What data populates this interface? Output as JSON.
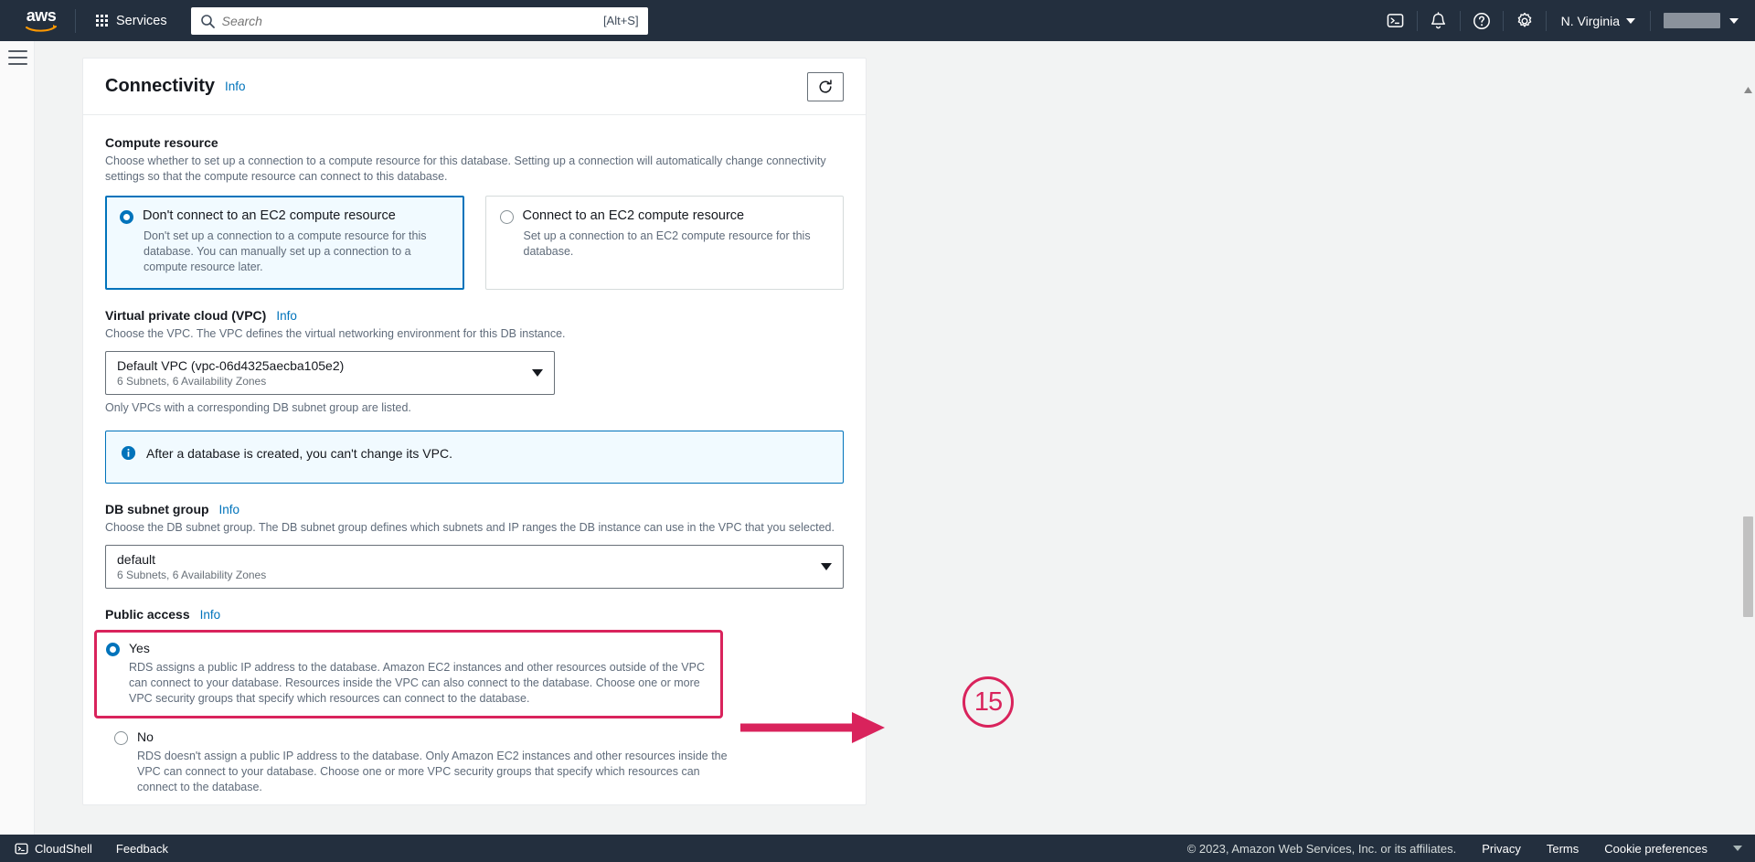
{
  "topnav": {
    "logo_alt": "aws",
    "services_label": "Services",
    "search_placeholder": "Search",
    "search_value": "",
    "search_shortcut": "[Alt+S]",
    "cloudshell_icon": "cloudshell-icon",
    "notifications_icon": "bell-icon",
    "help_icon": "question-circle-icon",
    "settings_icon": "gear-icon",
    "region_label": "N. Virginia",
    "account_label": ""
  },
  "panel": {
    "title": "Connectivity",
    "info_label": "Info",
    "refresh_icon": "refresh-icon"
  },
  "compute_resource": {
    "label": "Compute resource",
    "description": "Choose whether to set up a connection to a compute resource for this database. Setting up a connection will automatically change connectivity settings so that the compute resource can connect to this database.",
    "options": [
      {
        "title": "Don't connect to an EC2 compute resource",
        "description": "Don't set up a connection to a compute resource for this database. You can manually set up a connection to a compute resource later.",
        "selected": true
      },
      {
        "title": "Connect to an EC2 compute resource",
        "description": "Set up a connection to an EC2 compute resource for this database.",
        "selected": false
      }
    ]
  },
  "vpc": {
    "label": "Virtual private cloud (VPC)",
    "info_label": "Info",
    "description": "Choose the VPC. The VPC defines the virtual networking environment for this DB instance.",
    "selected_value": "Default VPC (vpc-06d4325aecba105e2)",
    "selected_sub": "6 Subnets, 6 Availability Zones",
    "helper": "Only VPCs with a corresponding DB subnet group are listed."
  },
  "vpc_alert": {
    "icon": "info-circle-icon",
    "text": "After a database is created, you can't change its VPC."
  },
  "db_subnet_group": {
    "label": "DB subnet group",
    "info_label": "Info",
    "description": "Choose the DB subnet group. The DB subnet group defines which subnets and IP ranges the DB instance can use in the VPC that you selected.",
    "selected_value": "default",
    "selected_sub": "6 Subnets, 6 Availability Zones"
  },
  "public_access": {
    "label": "Public access",
    "info_label": "Info",
    "options": [
      {
        "title": "Yes",
        "description": "RDS assigns a public IP address to the database. Amazon EC2 instances and other resources outside of the VPC can connect to your database. Resources inside the VPC can also connect to the database. Choose one or more VPC security groups that specify which resources can connect to the database.",
        "selected": true,
        "highlighted": true
      },
      {
        "title": "No",
        "description": "RDS doesn't assign a public IP address to the database. Only Amazon EC2 instances and other resources inside the VPC can connect to your database. Choose one or more VPC security groups that specify which resources can connect to the database.",
        "selected": false,
        "highlighted": false
      }
    ]
  },
  "annotation": {
    "step_number": "15",
    "color": "#d9235c"
  },
  "footer": {
    "cloudshell_label": "CloudShell",
    "feedback_label": "Feedback",
    "copyright": "© 2023, Amazon Web Services, Inc. or its affiliates.",
    "privacy_label": "Privacy",
    "terms_label": "Terms",
    "cookie_label": "Cookie preferences"
  },
  "colors": {
    "nav_bg": "#232f3e",
    "accent_blue": "#0073bb",
    "annotation": "#d9235c",
    "page_bg": "#f2f3f3"
  }
}
